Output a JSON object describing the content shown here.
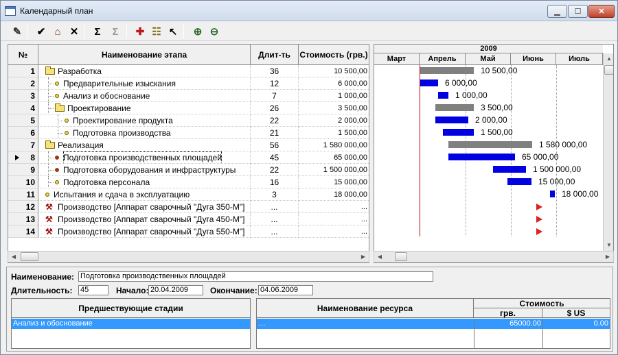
{
  "window": {
    "title": "Календарный план"
  },
  "toolbar": {
    "buttons": [
      {
        "name": "edit-document-icon",
        "glyph": "✎"
      },
      {
        "name": "check-icon",
        "glyph": "✔"
      },
      {
        "name": "factory-icon",
        "glyph": "⌂"
      },
      {
        "name": "delete-icon",
        "glyph": "✕"
      },
      {
        "name": "sum-add-icon",
        "glyph": "Σ"
      },
      {
        "name": "sum-remove-icon",
        "glyph": "Σ"
      },
      {
        "name": "add-icon",
        "glyph": "✚"
      },
      {
        "name": "hierarchy-icon",
        "glyph": "☷"
      },
      {
        "name": "pointer-icon",
        "glyph": "↖"
      },
      {
        "name": "zoom-in-icon",
        "glyph": "⊕"
      },
      {
        "name": "zoom-out-icon",
        "glyph": "⊖"
      }
    ]
  },
  "grid": {
    "headers": {
      "num": "№",
      "name": "Наименование этапа",
      "duration": "Длит-ть",
      "cost": "Стоимость (грв.)"
    },
    "rows": [
      {
        "num": "1",
        "name": "Разработка",
        "duration": "36",
        "cost": "10 500,00",
        "icon": "folder",
        "level": 0
      },
      {
        "num": "2",
        "name": "Предварительные изыскания",
        "duration": "12",
        "cost": "6 000,00",
        "icon": "dot-yellow",
        "level": 1
      },
      {
        "num": "3",
        "name": "Анализ и обоснование",
        "duration": "7",
        "cost": "1 000,00",
        "icon": "dot-yellow",
        "level": 1
      },
      {
        "num": "4",
        "name": "Проектирование",
        "duration": "26",
        "cost": "3 500,00",
        "icon": "folder",
        "level": 1
      },
      {
        "num": "5",
        "name": "Проектирование продукта",
        "duration": "22",
        "cost": "2 000,00",
        "icon": "dot-yellow",
        "level": 2
      },
      {
        "num": "6",
        "name": "Подготовка производства",
        "duration": "21",
        "cost": "1 500,00",
        "icon": "dot-yellow",
        "level": 2
      },
      {
        "num": "7",
        "name": "Реализация",
        "duration": "56",
        "cost": "1 580 000,00",
        "icon": "folder",
        "level": 0
      },
      {
        "num": "8",
        "name": "Подготовка производственных площадей",
        "duration": "45",
        "cost": "65 000,00",
        "icon": "dot-red",
        "level": 1
      },
      {
        "num": "9",
        "name": "Подготовка оборудования и инфраструктуры",
        "duration": "22",
        "cost": "1 500 000,00",
        "icon": "dot-red",
        "level": 1
      },
      {
        "num": "10",
        "name": "Подготовка персонала",
        "duration": "16",
        "cost": "15 000,00",
        "icon": "dot-yellow",
        "level": 1
      },
      {
        "num": "11",
        "name": "Испытания и сдача в эксплуатацию",
        "duration": "3",
        "cost": "18 000,00",
        "icon": "dot-yellow",
        "level": 0
      },
      {
        "num": "12",
        "name": "Производство [Аппарат сварочный \"Дуга 350-М\"]",
        "duration": "...",
        "cost": "...",
        "icon": "resource",
        "level": 0
      },
      {
        "num": "13",
        "name": "Производство [Аппарат сварочный \"Дуга 450-М\"]",
        "duration": "...",
        "cost": "...",
        "icon": "resource",
        "level": 0
      },
      {
        "num": "14",
        "name": "Производство [Аппарат сварочный \"Дуга 550-М\"]",
        "duration": "...",
        "cost": "...",
        "icon": "resource",
        "level": 0
      }
    ],
    "current_row": "8"
  },
  "gantt": {
    "year": "2009",
    "months": [
      "Март",
      "Апрель",
      "Май",
      "Июнь",
      "Июль"
    ],
    "bars": [
      {
        "row": 1,
        "kind": "group",
        "label": "10 500,00"
      },
      {
        "row": 2,
        "kind": "task",
        "label": "6 000,00"
      },
      {
        "row": 3,
        "kind": "task",
        "label": "1 000,00"
      },
      {
        "row": 4,
        "kind": "group",
        "label": "3 500,00"
      },
      {
        "row": 5,
        "kind": "task",
        "label": "2 000,00"
      },
      {
        "row": 6,
        "kind": "task",
        "label": "1 500,00"
      },
      {
        "row": 7,
        "kind": "group",
        "label": "1 580 000,00"
      },
      {
        "row": 8,
        "kind": "task",
        "label": "65 000,00"
      },
      {
        "row": 9,
        "kind": "task",
        "label": "1 500 000,00"
      },
      {
        "row": 10,
        "kind": "task",
        "label": "15 000,00"
      },
      {
        "row": 11,
        "kind": "task",
        "label": "18 000,00"
      },
      {
        "row": 12,
        "kind": "flag",
        "label": ""
      },
      {
        "row": 13,
        "kind": "flag",
        "label": ""
      },
      {
        "row": 14,
        "kind": "flag",
        "label": ""
      }
    ]
  },
  "details": {
    "name_label": "Наименование:",
    "name_value": "Подготовка производственных площадей",
    "duration_label": "Длительность:",
    "duration_value": "45",
    "start_label": "Начало:",
    "start_value": "20.04.2009",
    "end_label": "Окончание:",
    "end_value": "04.06.2009",
    "predecessors_header": "Предшествующие стадии",
    "predecessors": [
      "Анализ и обоснование"
    ],
    "resource_header": "Наименование ресурса",
    "cost_header": "Стоимость",
    "cost_uah_header": "грв.",
    "cost_usd_header": "$ US",
    "resources": [
      {
        "name": "...",
        "uah": "65000.00",
        "usd": "0.00"
      }
    ]
  },
  "colors": {
    "group_bar": "#808080",
    "task_bar": "#0000e0",
    "today_line": "#c00000",
    "selection": "#3399ff",
    "milestone_flag": "#e02020"
  }
}
